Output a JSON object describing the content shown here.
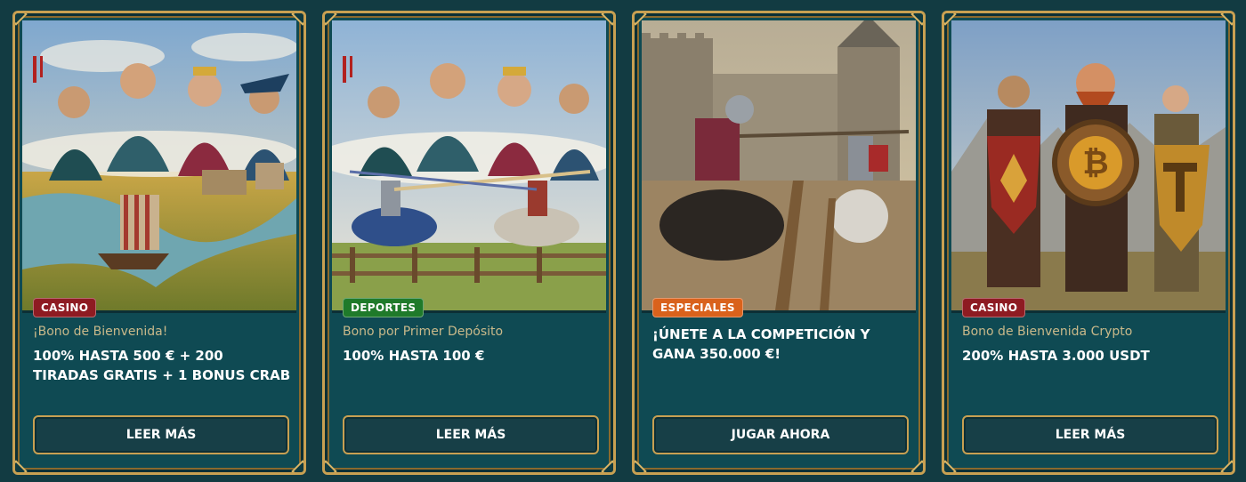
{
  "colors": {
    "background": "#123b42",
    "card_panel": "#0f4a53",
    "gold_border": "#c8a052",
    "badge_casino": "#8e1b22",
    "badge_deportes": "#1f7a2a",
    "badge_especiales": "#d9621c",
    "subtitle_text": "#c9b98a"
  },
  "cards": [
    {
      "badge": "CASINO",
      "badge_color": "#8e1b22",
      "subtitle": "¡Bono de Bienvenida!",
      "title": "100% HASTA 500 € + 200 TIRADAS GRATIS + 1 BONUS CRAB",
      "button": "LEER MÁS",
      "image": "historical-leaders-viking-ship-landscape"
    },
    {
      "badge": "DEPORTES",
      "badge_color": "#1f7a2a",
      "subtitle": "Bono por Primer Depósito",
      "title": "100% HASTA 100 €",
      "button": "LEER MÁS",
      "image": "historical-leaders-jousting-knights"
    },
    {
      "badge": "ESPECIALES",
      "badge_color": "#d9621c",
      "subtitle": "",
      "title": "¡ÚNETE A LA COMPETICIÓN Y GANA 350.000 €!",
      "button": "JUGAR AHORA",
      "image": "jousting-knights-castle"
    },
    {
      "badge": "CASINO",
      "badge_color": "#8e1b22",
      "subtitle": "Bono de Bienvenida Crypto",
      "title": "200% HASTA 3.000 USDT",
      "button": "LEER MÁS",
      "image": "warriors-crypto-shields"
    }
  ]
}
